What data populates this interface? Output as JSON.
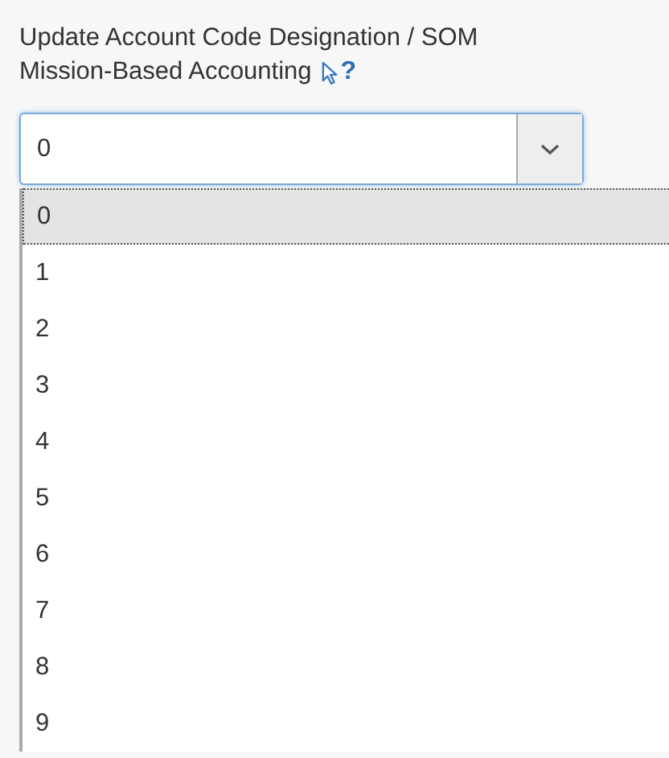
{
  "field": {
    "label_lines": [
      "Update Account Code Designation / SOM",
      "Mission-Based Accounting"
    ],
    "help_mark": "?",
    "value": "0",
    "expanded": true
  },
  "options": [
    {
      "label": "0",
      "selected": true
    },
    {
      "label": "1",
      "selected": false
    },
    {
      "label": "2",
      "selected": false
    },
    {
      "label": "3",
      "selected": false
    },
    {
      "label": "4",
      "selected": false
    },
    {
      "label": "5",
      "selected": false
    },
    {
      "label": "6",
      "selected": false
    },
    {
      "label": "7",
      "selected": false
    },
    {
      "label": "8",
      "selected": false
    },
    {
      "label": "9",
      "selected": false
    }
  ]
}
